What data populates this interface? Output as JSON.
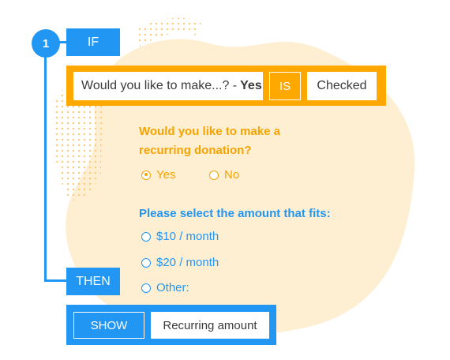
{
  "colors": {
    "primary": "#2196f3",
    "accent": "#ffa800",
    "blob": "#fde9c3"
  },
  "logic": {
    "step_number": "1",
    "if_label": "IF",
    "then_label": "THEN",
    "condition": {
      "question": "Would you like to make...? -",
      "answer": "Yes",
      "operator": "IS",
      "value": "Checked"
    },
    "action": {
      "verb": "SHOW",
      "target": "Recurring amount"
    }
  },
  "form": {
    "question1": "Would you like to make a recurring donation?",
    "q1_options": [
      {
        "label": "Yes",
        "checked": true
      },
      {
        "label": "No",
        "checked": false
      }
    ],
    "question2": "Please select the amount that fits:",
    "q2_options": [
      {
        "label": "$10 / month"
      },
      {
        "label": "$20 / month"
      },
      {
        "label": "Other:"
      }
    ]
  }
}
